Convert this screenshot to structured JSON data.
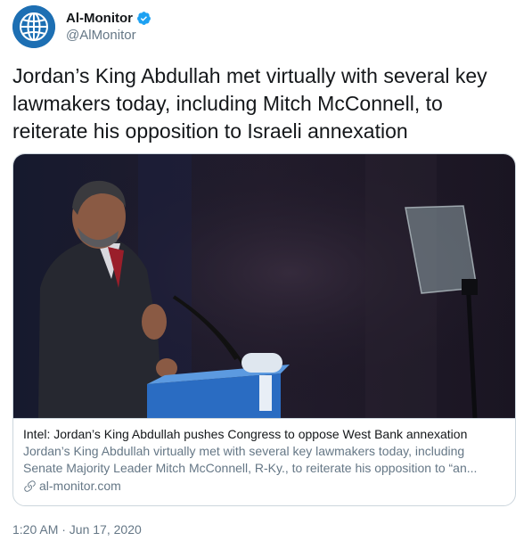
{
  "author": {
    "display_name": "Al-Monitor",
    "handle": "@AlMonitor",
    "avatar_icon": "globe-logo-icon",
    "verified_icon": "verified-badge-icon",
    "brand_color": "#1d6fb3",
    "verified_color": "#1da1f2"
  },
  "tweet": {
    "text": "Jordan’s King Abdullah met virtually with several key lawmakers today, including Mitch McConnell, to reiterate his opposition to Israeli annexation"
  },
  "link_card": {
    "image_description_icon": "speaker-at-podium-photo",
    "title": "Intel: Jordan’s King Abdullah pushes Congress to oppose West Bank annexation",
    "description": "Jordan’s King Abdullah virtually met with several key lawmakers today, including Senate Majority Leader Mitch McConnell, R-Ky., to reiterate his opposition to “an...",
    "domain": "al-monitor.com",
    "link_icon": "link-icon"
  },
  "timestamp": "1:20 AM · Jun 17, 2020",
  "colors": {
    "text": "#14171a",
    "secondary_text": "#657786",
    "border": "#ccd6dd"
  }
}
